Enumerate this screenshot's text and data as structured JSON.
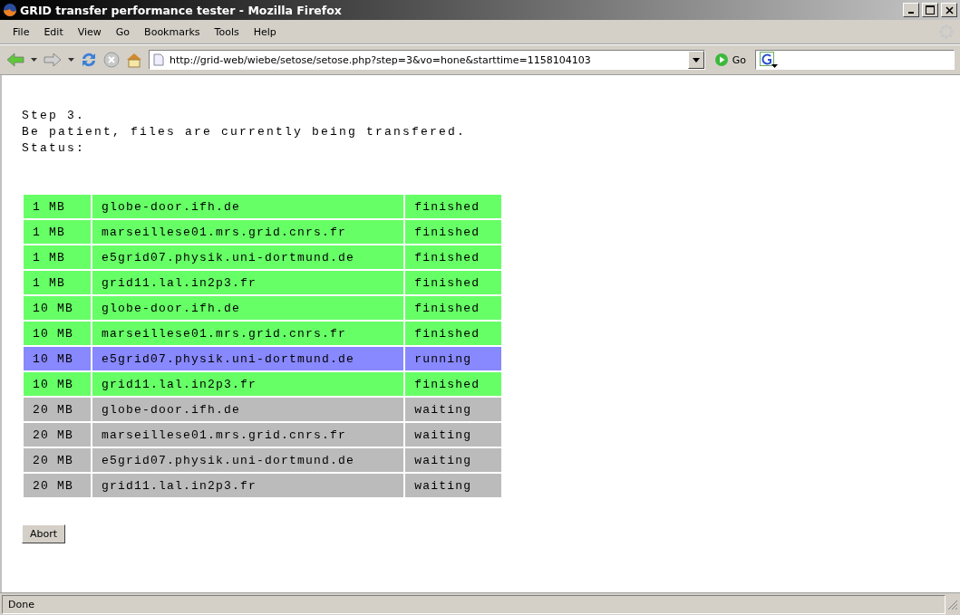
{
  "window": {
    "title": "GRID transfer performance tester - Mozilla Firefox"
  },
  "menu": [
    "File",
    "Edit",
    "View",
    "Go",
    "Bookmarks",
    "Tools",
    "Help"
  ],
  "address": {
    "value": "http://grid-web/wiebe/setose/setose.php?step=3&vo=hone&starttime=1158104103"
  },
  "go_button": "Go",
  "page": {
    "lines": [
      "Step 3.",
      "Be patient, files are currently being transfered.",
      "Status:"
    ],
    "rows": [
      {
        "size": "1 MB",
        "host": "globe-door.ifh.de",
        "status": "finished",
        "color": "#66ff66"
      },
      {
        "size": "1 MB",
        "host": "marseillese01.mrs.grid.cnrs.fr",
        "status": "finished",
        "color": "#66ff66"
      },
      {
        "size": "1 MB",
        "host": "e5grid07.physik.uni-dortmund.de",
        "status": "finished",
        "color": "#66ff66"
      },
      {
        "size": "1 MB",
        "host": "grid11.lal.in2p3.fr",
        "status": "finished",
        "color": "#66ff66"
      },
      {
        "size": "10 MB",
        "host": "globe-door.ifh.de",
        "status": "finished",
        "color": "#66ff66"
      },
      {
        "size": "10 MB",
        "host": "marseillese01.mrs.grid.cnrs.fr",
        "status": "finished",
        "color": "#66ff66"
      },
      {
        "size": "10 MB",
        "host": "e5grid07.physik.uni-dortmund.de",
        "status": "running",
        "color": "#8888ff"
      },
      {
        "size": "10 MB",
        "host": "grid11.lal.in2p3.fr",
        "status": "finished",
        "color": "#66ff66"
      },
      {
        "size": "20 MB",
        "host": "globe-door.ifh.de",
        "status": "waiting",
        "color": "#bbbbbb"
      },
      {
        "size": "20 MB",
        "host": "marseillese01.mrs.grid.cnrs.fr",
        "status": "waiting",
        "color": "#bbbbbb"
      },
      {
        "size": "20 MB",
        "host": "e5grid07.physik.uni-dortmund.de",
        "status": "waiting",
        "color": "#bbbbbb"
      },
      {
        "size": "20 MB",
        "host": "grid11.lal.in2p3.fr",
        "status": "waiting",
        "color": "#bbbbbb"
      }
    ],
    "abort_button": "Abort"
  },
  "status_bar": "Done"
}
